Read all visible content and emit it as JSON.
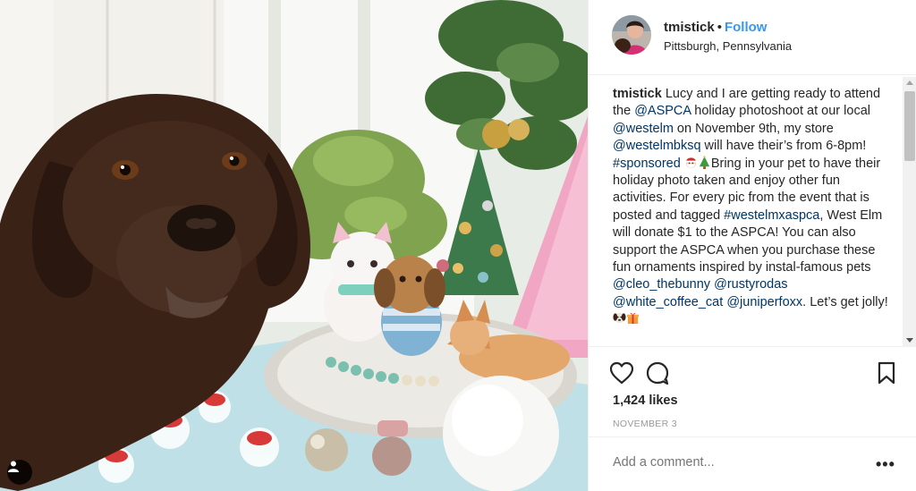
{
  "header": {
    "username": "tmistick",
    "separator": "•",
    "follow_label": "Follow",
    "location": "Pittsburgh, Pennsylvania"
  },
  "caption": {
    "username": "tmistick",
    "t1": "Lucy and I are getting ready to attend the ",
    "m1": "@ASPCA",
    "t2": " holiday photoshoot at our local ",
    "m2": "@westelm",
    "t3": " on November 9th, my store ",
    "m3": "@westelmbksq",
    "t4": " will have their’s from 6-8pm! ",
    "m4": "#sponsored",
    "t5": "Bring in your pet to have their holiday photo taken and enjoy other fun activities. For every pic from the event that is posted and tagged ",
    "m5": "#westelmxaspca",
    "t6": ", West Elm will donate $1 to the ASPCA! You can also support the ASPCA when you purchase these fun ornaments inspired by instal-famous pets ",
    "m6": "@cleo_thebunny",
    "t7": " ",
    "m7": "@rustyrodas",
    "t8": " ",
    "m8": "@white_coffee_cat",
    "t9": " ",
    "m9": "@juniperfoxx",
    "t10": ". Let’s get jolly! ",
    "emoji_after_sponsored": [
      "santa-emoji",
      "christmas-tree-emoji"
    ],
    "emoji_end": [
      "dog-emoji",
      "gift-emoji"
    ]
  },
  "actions": {
    "icons": [
      "heart-icon",
      "comment-icon",
      "bookmark-icon"
    ]
  },
  "likes": "1,424 likes",
  "date": "NOVEMBER 3",
  "comment": {
    "placeholder": "Add a comment...",
    "more_label": "•••"
  },
  "colors": {
    "link": "#3897f0",
    "mention": "#003569",
    "text": "#262626",
    "muted": "#999999",
    "border": "#efefef"
  }
}
